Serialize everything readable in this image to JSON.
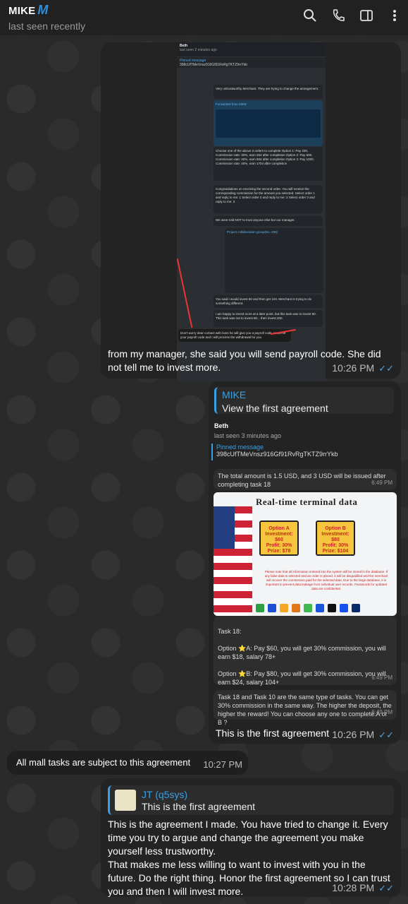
{
  "header": {
    "name": "MIKE",
    "name_mark": "M",
    "status": "last seen recently"
  },
  "message1": {
    "screenshot": {
      "title": "Beth",
      "seen": "last seen 2 minutes ago",
      "pinned_label": "Pinned message",
      "pinned_code": "398cUfTMeVnsz916Gf91RvRgTKTZ9rrYkb",
      "msg_untrust": "Very untrustworthy Merchant. They are trying to change the arrangement.",
      "forwarded": "Forwarded from MIKE",
      "options": "Choose one of the above 3 orders to complete Option 1: Pay 200, Commission rate: 30%, earn 264 after completion Option 2: Pay 500, Commission rate: 40%, earn 804 after completion Option 3: Pay 1000, Commission rate: 40%, earn 1704 after completion",
      "congrats": "Congratulations on receiving the second order. You will receive the corresponding commission for the amount you selected. Select order 1 and reply to me: 1 Select order 2 and reply to me: 2 Select order 3 and reply to me: 3",
      "told_not_trust": "We were told NOT to trust anyone else but our manager.",
      "project_group": "Project collaboration group(No. 836)",
      "said_invest": "You said I would invest 80 and then get 104. Merchant is trying to do something different.",
      "happy_later": "I am happy to invest more at a later point, but this task was to invest 80. This task was not to invest 80... then invest 200.",
      "bottom": "Don't worry dear contact with boss he will give you a payroll code, send me your payroll code and I will process the withdrawal for you"
    },
    "caption": "from my manager, she said you will send payroll code.  She did not tell me to invest more.",
    "time": "10:26 PM"
  },
  "message2": {
    "reply_name": "MIKE",
    "reply_text": "View the first agreement",
    "inner_name": "Beth",
    "inner_seen": "last seen 3 minutes ago",
    "pinned_label": "Pinned message",
    "pinned_code": "398cUfTMeVnsz916Gf91RvRgTKTZ9rrYkb",
    "total_msg": "The total amount is 1.5 USD, and 3 USD will be issued after completing task 18",
    "total_time": "6:49 PM",
    "poster_title": "Real-time terminal data",
    "option_a": {
      "title": "Option A",
      "investment": "Investment: $60",
      "profit": "Profit: 30%",
      "prize": "Prize: $78"
    },
    "option_b": {
      "title": "Option B",
      "investment": "Investment: $80",
      "profit": "Profit: 30%",
      "prize": "Prize: $104"
    },
    "poster_note": "Please note that all information entered into the system will be stored in the database. If any false data is selected and an order is placed, it will be disqualified and the merchant will recover the commission paid for the selected data. Due to the large database, it is important to prevent data leakage from individual user records. Passwords for updated data are confidential.",
    "task_msg": "Task 18:\n\nOption ⭐A: Pay $60, you will get 30% commission, you will earn $18, salary 78+\n\nOption ⭐B: Pay $80, you will get 30% commission, you will earn $24, salary 104+\n\n👇👇👇👇👇👇👇",
    "task_time": "6:49 PM",
    "same_msg": "Task 18 and Task 10 are the same type of tasks. You can get 30% commission in the same way. The higher the deposit, the higher the reward! You can choose any one to complete.A or B ?",
    "same_time": "6:49 PM",
    "caption": "This is the first agreement",
    "time": "10:26 PM"
  },
  "message3": {
    "text": "All mall tasks are subject to this agreement",
    "time": "10:27 PM"
  },
  "message4": {
    "reply_name": "JT (q5sys)",
    "reply_text": "This is the first agreement",
    "body": "This is the agreement I made.  You have tried to change it.  Every time you try to argue and change the agreement you make yourself less trustworthy.\nThat makes me less willing to want to invest with you in the future.  Do the right thing.  Honor the first agreement so I can trust you and then I will invest more.",
    "time": "10:28 PM"
  },
  "colors": {
    "accent": "#3aa0e6",
    "bubble": "#232323",
    "header": "#212121"
  },
  "icons": [
    "search-icon",
    "phone-icon",
    "sidebar-icon",
    "more-icon"
  ]
}
